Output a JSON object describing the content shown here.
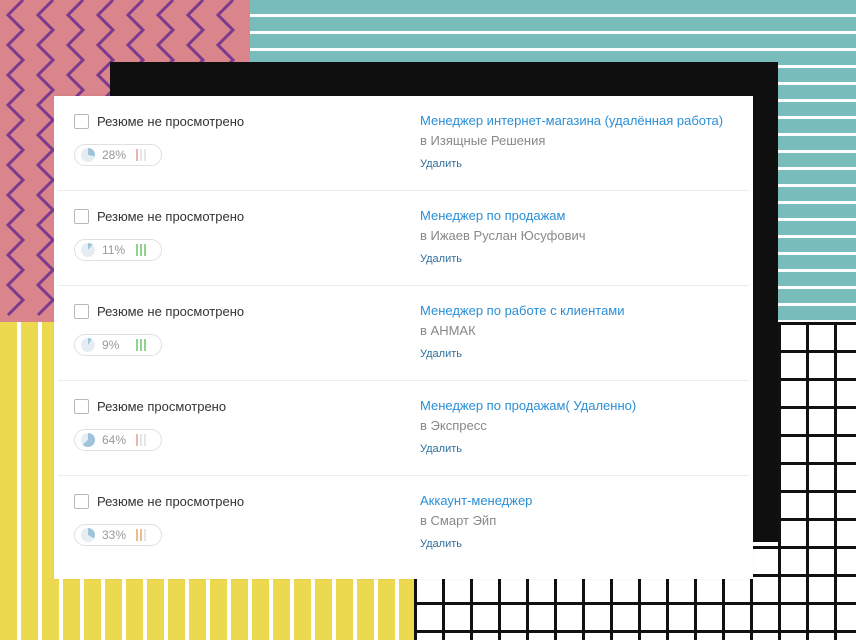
{
  "colors": {
    "link": "#2a8fd6",
    "pie_fill": "#9fc3db",
    "bar_low": "#e8b5b5",
    "bar_high": "#8fd48f",
    "bar_mid": "#e7c08e"
  },
  "items": [
    {
      "status": "Резюме не просмотрено",
      "match_percent": "28%",
      "match_value": 28,
      "bars_color": "#e8b5b5",
      "bars_active": 1,
      "job_title": "Менеджер интернет-магазина (удалённая работа)",
      "company": "в Изящные Решения",
      "delete_label": "Удалить"
    },
    {
      "status": "Резюме не просмотрено",
      "match_percent": "11%",
      "match_value": 11,
      "bars_color": "#8fd48f",
      "bars_active": 3,
      "job_title": "Менеджер по продажам",
      "company": "в Ижаев Руслан Юсуфович",
      "delete_label": "Удалить"
    },
    {
      "status": "Резюме не просмотрено",
      "match_percent": "9%",
      "match_value": 9,
      "bars_color": "#8fd48f",
      "bars_active": 3,
      "job_title": "Менеджер по работе с клиентами",
      "company": "в АНМАК",
      "delete_label": "Удалить"
    },
    {
      "status": "Резюме просмотрено",
      "match_percent": "64%",
      "match_value": 64,
      "bars_color": "#e8b5b5",
      "bars_active": 1,
      "job_title": "Менеджер по продажам( Удаленно)",
      "company": "в Экспресс",
      "delete_label": "Удалить"
    },
    {
      "status": "Резюме не просмотрено",
      "match_percent": "33%",
      "match_value": 33,
      "bars_color": "#e7c08e",
      "bars_active": 2,
      "job_title": "Аккаунт-менеджер",
      "company": "в Смарт Эйп",
      "delete_label": "Удалить"
    }
  ]
}
